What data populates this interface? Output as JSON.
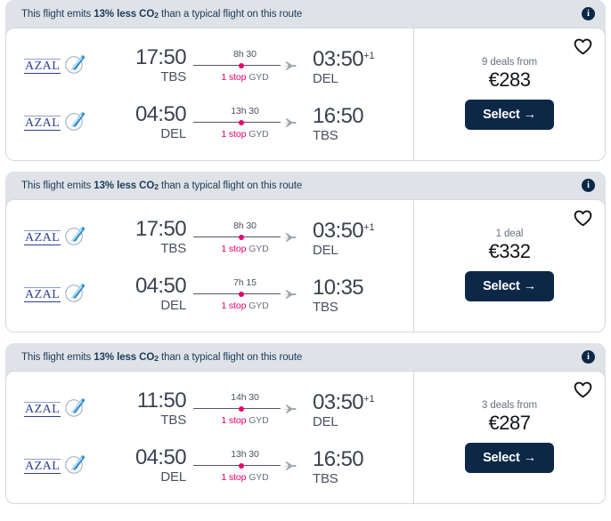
{
  "colors": {
    "accent_pink": "#e5006d",
    "navy": "#0d2847",
    "banner_bg": "#dfe3e8",
    "card_bg": "#ffffff",
    "text_dark": "#3a4250",
    "text_muted": "#6a7180"
  },
  "icons": {
    "info": "i",
    "heart": "heart-outline-icon",
    "plane": "plane-icon",
    "arrow": "→"
  },
  "eco_banner": {
    "prefix": "This flight emits ",
    "highlight": "13% less CO",
    "subscript": "2",
    "suffix": " than a typical flight on this route",
    "info_tooltip": "i"
  },
  "flights": [
    {
      "eco": {
        "prefix": "This flight emits ",
        "highlight": "13% less CO",
        "subscript": "2",
        "suffix": " than a typical flight on this route"
      },
      "legs": [
        {
          "airline": "AZAL",
          "depart_time": "17:50",
          "depart_airport": "TBS",
          "duration": "8h 30",
          "stops": "1 stop",
          "via": "GYD",
          "arrive_time": "03:50",
          "day_offset": "+1",
          "arrive_airport": "DEL"
        },
        {
          "airline": "AZAL",
          "depart_time": "04:50",
          "depart_airport": "DEL",
          "duration": "13h 30",
          "stops": "1 stop",
          "via": "GYD",
          "arrive_time": "16:50",
          "day_offset": "",
          "arrive_airport": "TBS"
        }
      ],
      "deals_label": "9 deals from",
      "price": "€283",
      "select_label": "Select"
    },
    {
      "eco": {
        "prefix": "This flight emits ",
        "highlight": "13% less CO",
        "subscript": "2",
        "suffix": " than a typical flight on this route"
      },
      "legs": [
        {
          "airline": "AZAL",
          "depart_time": "17:50",
          "depart_airport": "TBS",
          "duration": "8h 30",
          "stops": "1 stop",
          "via": "GYD",
          "arrive_time": "03:50",
          "day_offset": "+1",
          "arrive_airport": "DEL"
        },
        {
          "airline": "AZAL",
          "depart_time": "04:50",
          "depart_airport": "DEL",
          "duration": "7h 15",
          "stops": "1 stop",
          "via": "GYD",
          "arrive_time": "10:35",
          "day_offset": "",
          "arrive_airport": "TBS"
        }
      ],
      "deals_label": "1 deal",
      "price": "€332",
      "select_label": "Select"
    },
    {
      "eco": {
        "prefix": "This flight emits ",
        "highlight": "13% less CO",
        "subscript": "2",
        "suffix": " than a typical flight on this route"
      },
      "legs": [
        {
          "airline": "AZAL",
          "depart_time": "11:50",
          "depart_airport": "TBS",
          "duration": "14h 30",
          "stops": "1 stop",
          "via": "GYD",
          "arrive_time": "03:50",
          "day_offset": "+1",
          "arrive_airport": "DEL"
        },
        {
          "airline": "AZAL",
          "depart_time": "04:50",
          "depart_airport": "DEL",
          "duration": "13h 30",
          "stops": "1 stop",
          "via": "GYD",
          "arrive_time": "16:50",
          "day_offset": "",
          "arrive_airport": "TBS"
        }
      ],
      "deals_label": "3 deals from",
      "price": "€287",
      "select_label": "Select"
    }
  ]
}
